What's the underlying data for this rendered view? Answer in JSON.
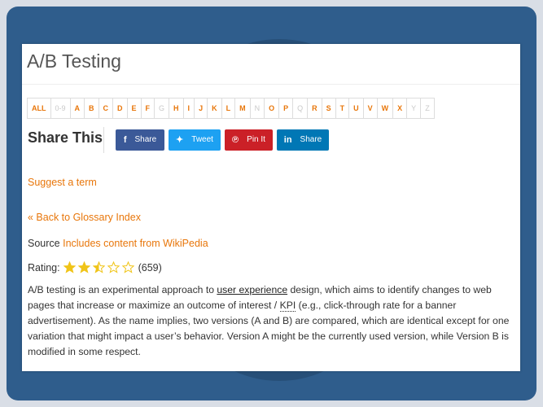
{
  "page": {
    "title": "A/B Testing"
  },
  "alphabet": [
    {
      "label": "ALL",
      "enabled": true
    },
    {
      "label": "0-9",
      "enabled": false
    },
    {
      "label": "A",
      "enabled": true
    },
    {
      "label": "B",
      "enabled": true
    },
    {
      "label": "C",
      "enabled": true
    },
    {
      "label": "D",
      "enabled": true
    },
    {
      "label": "E",
      "enabled": true
    },
    {
      "label": "F",
      "enabled": true
    },
    {
      "label": "G",
      "enabled": false
    },
    {
      "label": "H",
      "enabled": true
    },
    {
      "label": "I",
      "enabled": true
    },
    {
      "label": "J",
      "enabled": true
    },
    {
      "label": "K",
      "enabled": true
    },
    {
      "label": "L",
      "enabled": true
    },
    {
      "label": "M",
      "enabled": true
    },
    {
      "label": "N",
      "enabled": false
    },
    {
      "label": "O",
      "enabled": true
    },
    {
      "label": "P",
      "enabled": true
    },
    {
      "label": "Q",
      "enabled": false
    },
    {
      "label": "R",
      "enabled": true
    },
    {
      "label": "S",
      "enabled": true
    },
    {
      "label": "T",
      "enabled": true
    },
    {
      "label": "U",
      "enabled": true
    },
    {
      "label": "V",
      "enabled": true
    },
    {
      "label": "W",
      "enabled": true
    },
    {
      "label": "X",
      "enabled": true
    },
    {
      "label": "Y",
      "enabled": false
    },
    {
      "label": "Z",
      "enabled": false
    }
  ],
  "share": {
    "title": "Share This",
    "facebook": {
      "icon": "facebook-icon",
      "glyph": "f",
      "label": "Share"
    },
    "twitter": {
      "icon": "twitter-icon",
      "glyph": "✦",
      "label": "Tweet"
    },
    "pinterest": {
      "icon": "pinterest-icon",
      "glyph": "℗",
      "label": "Pin It"
    },
    "linkedin": {
      "icon": "linkedin-icon",
      "glyph": "in",
      "label": "Share"
    }
  },
  "links": {
    "suggest": "Suggest a term",
    "back": "« Back to Glossary Index"
  },
  "source": {
    "label": "Source",
    "link": "Includes content from WikiPedia"
  },
  "rating": {
    "label": "Rating:",
    "value": 2.5,
    "max": 5,
    "count": "(659)"
  },
  "description": {
    "p1": "A/B testing is an experimental approach to ",
    "link1": "user experience",
    "p2": " design, which aims to identify changes to web pages that increase or maximize an outcome of interest / ",
    "link2": "KPI",
    "p3": " (e.g., click-through rate for a banner advertisement). As the name implies, two versions (A and B) are compared, which are identical except for one variation that might impact a user’s behavior. Version A might be the currently used version, while Version B is modified in some respect."
  },
  "colors": {
    "accent": "#e8760a",
    "frame": "#2f5d8c",
    "star": "#f0c419"
  }
}
